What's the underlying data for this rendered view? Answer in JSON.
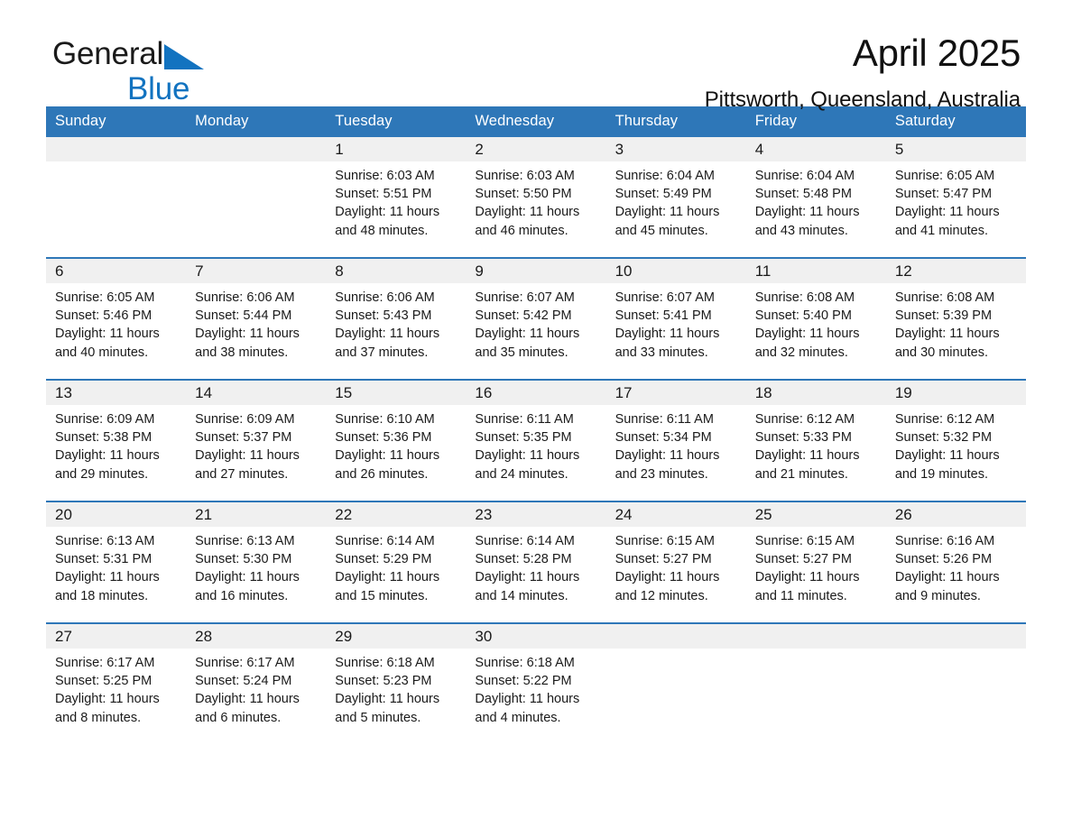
{
  "brand": {
    "word1": "General",
    "word2": "Blue",
    "flag_icon": "triangle-flag-icon",
    "flag_color": "#1273c0",
    "word2_color": "#1273c0"
  },
  "header": {
    "title": "April 2025",
    "location": "Pittsworth, Queensland, Australia"
  },
  "theme": {
    "header_blue": "#2e77b8",
    "date_band_gray": "#f0f0f0",
    "divider_blue": "#2e77b8",
    "text_color": "#1a1a1a"
  },
  "weekday_headers": [
    "Sunday",
    "Monday",
    "Tuesday",
    "Wednesday",
    "Thursday",
    "Friday",
    "Saturday"
  ],
  "labels": {
    "sunrise_prefix": "Sunrise:",
    "sunset_prefix": "Sunset:",
    "daylight_prefix": "Daylight:"
  },
  "weeks": [
    [
      {
        "blank": true
      },
      {
        "blank": true
      },
      {
        "date": "1",
        "sunrise": "Sunrise: 6:03 AM",
        "sunset": "Sunset: 5:51 PM",
        "daylight": "Daylight: 11 hours and 48 minutes."
      },
      {
        "date": "2",
        "sunrise": "Sunrise: 6:03 AM",
        "sunset": "Sunset: 5:50 PM",
        "daylight": "Daylight: 11 hours and 46 minutes."
      },
      {
        "date": "3",
        "sunrise": "Sunrise: 6:04 AM",
        "sunset": "Sunset: 5:49 PM",
        "daylight": "Daylight: 11 hours and 45 minutes."
      },
      {
        "date": "4",
        "sunrise": "Sunrise: 6:04 AM",
        "sunset": "Sunset: 5:48 PM",
        "daylight": "Daylight: 11 hours and 43 minutes."
      },
      {
        "date": "5",
        "sunrise": "Sunrise: 6:05 AM",
        "sunset": "Sunset: 5:47 PM",
        "daylight": "Daylight: 11 hours and 41 minutes."
      }
    ],
    [
      {
        "date": "6",
        "sunrise": "Sunrise: 6:05 AM",
        "sunset": "Sunset: 5:46 PM",
        "daylight": "Daylight: 11 hours and 40 minutes."
      },
      {
        "date": "7",
        "sunrise": "Sunrise: 6:06 AM",
        "sunset": "Sunset: 5:44 PM",
        "daylight": "Daylight: 11 hours and 38 minutes."
      },
      {
        "date": "8",
        "sunrise": "Sunrise: 6:06 AM",
        "sunset": "Sunset: 5:43 PM",
        "daylight": "Daylight: 11 hours and 37 minutes."
      },
      {
        "date": "9",
        "sunrise": "Sunrise: 6:07 AM",
        "sunset": "Sunset: 5:42 PM",
        "daylight": "Daylight: 11 hours and 35 minutes."
      },
      {
        "date": "10",
        "sunrise": "Sunrise: 6:07 AM",
        "sunset": "Sunset: 5:41 PM",
        "daylight": "Daylight: 11 hours and 33 minutes."
      },
      {
        "date": "11",
        "sunrise": "Sunrise: 6:08 AM",
        "sunset": "Sunset: 5:40 PM",
        "daylight": "Daylight: 11 hours and 32 minutes."
      },
      {
        "date": "12",
        "sunrise": "Sunrise: 6:08 AM",
        "sunset": "Sunset: 5:39 PM",
        "daylight": "Daylight: 11 hours and 30 minutes."
      }
    ],
    [
      {
        "date": "13",
        "sunrise": "Sunrise: 6:09 AM",
        "sunset": "Sunset: 5:38 PM",
        "daylight": "Daylight: 11 hours and 29 minutes."
      },
      {
        "date": "14",
        "sunrise": "Sunrise: 6:09 AM",
        "sunset": "Sunset: 5:37 PM",
        "daylight": "Daylight: 11 hours and 27 minutes."
      },
      {
        "date": "15",
        "sunrise": "Sunrise: 6:10 AM",
        "sunset": "Sunset: 5:36 PM",
        "daylight": "Daylight: 11 hours and 26 minutes."
      },
      {
        "date": "16",
        "sunrise": "Sunrise: 6:11 AM",
        "sunset": "Sunset: 5:35 PM",
        "daylight": "Daylight: 11 hours and 24 minutes."
      },
      {
        "date": "17",
        "sunrise": "Sunrise: 6:11 AM",
        "sunset": "Sunset: 5:34 PM",
        "daylight": "Daylight: 11 hours and 23 minutes."
      },
      {
        "date": "18",
        "sunrise": "Sunrise: 6:12 AM",
        "sunset": "Sunset: 5:33 PM",
        "daylight": "Daylight: 11 hours and 21 minutes."
      },
      {
        "date": "19",
        "sunrise": "Sunrise: 6:12 AM",
        "sunset": "Sunset: 5:32 PM",
        "daylight": "Daylight: 11 hours and 19 minutes."
      }
    ],
    [
      {
        "date": "20",
        "sunrise": "Sunrise: 6:13 AM",
        "sunset": "Sunset: 5:31 PM",
        "daylight": "Daylight: 11 hours and 18 minutes."
      },
      {
        "date": "21",
        "sunrise": "Sunrise: 6:13 AM",
        "sunset": "Sunset: 5:30 PM",
        "daylight": "Daylight: 11 hours and 16 minutes."
      },
      {
        "date": "22",
        "sunrise": "Sunrise: 6:14 AM",
        "sunset": "Sunset: 5:29 PM",
        "daylight": "Daylight: 11 hours and 15 minutes."
      },
      {
        "date": "23",
        "sunrise": "Sunrise: 6:14 AM",
        "sunset": "Sunset: 5:28 PM",
        "daylight": "Daylight: 11 hours and 14 minutes."
      },
      {
        "date": "24",
        "sunrise": "Sunrise: 6:15 AM",
        "sunset": "Sunset: 5:27 PM",
        "daylight": "Daylight: 11 hours and 12 minutes."
      },
      {
        "date": "25",
        "sunrise": "Sunrise: 6:15 AM",
        "sunset": "Sunset: 5:27 PM",
        "daylight": "Daylight: 11 hours and 11 minutes."
      },
      {
        "date": "26",
        "sunrise": "Sunrise: 6:16 AM",
        "sunset": "Sunset: 5:26 PM",
        "daylight": "Daylight: 11 hours and 9 minutes."
      }
    ],
    [
      {
        "date": "27",
        "sunrise": "Sunrise: 6:17 AM",
        "sunset": "Sunset: 5:25 PM",
        "daylight": "Daylight: 11 hours and 8 minutes."
      },
      {
        "date": "28",
        "sunrise": "Sunrise: 6:17 AM",
        "sunset": "Sunset: 5:24 PM",
        "daylight": "Daylight: 11 hours and 6 minutes."
      },
      {
        "date": "29",
        "sunrise": "Sunrise: 6:18 AM",
        "sunset": "Sunset: 5:23 PM",
        "daylight": "Daylight: 11 hours and 5 minutes."
      },
      {
        "date": "30",
        "sunrise": "Sunrise: 6:18 AM",
        "sunset": "Sunset: 5:22 PM",
        "daylight": "Daylight: 11 hours and 4 minutes."
      },
      {
        "blank": true
      },
      {
        "blank": true
      },
      {
        "blank": true
      }
    ]
  ]
}
